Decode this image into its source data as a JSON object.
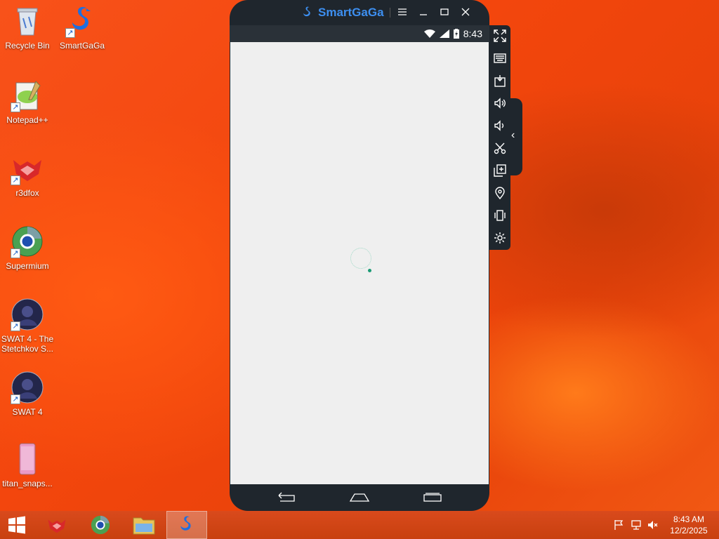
{
  "desktop": {
    "icons": [
      {
        "label": "Recycle Bin"
      },
      {
        "label": "SmartGaGa"
      },
      {
        "label": "Notepad++"
      },
      {
        "label": "r3dfox"
      },
      {
        "label": "Supermium"
      },
      {
        "label": "SWAT 4 - The Stetchkov S..."
      },
      {
        "label": "SWAT 4"
      },
      {
        "label": "titan_snaps..."
      }
    ]
  },
  "emulator": {
    "title": "SmartGaGa",
    "status_time": "8:43",
    "toolbar": [
      "fullscreen-icon",
      "keyboard-icon",
      "apk-install-icon",
      "volume-up-icon",
      "volume-down-icon",
      "screenshot-icon",
      "multi-instance-icon",
      "location-icon",
      "shake-icon",
      "settings-icon"
    ],
    "accent": "#3d8ff0"
  },
  "taskbar": {
    "clock_time": "8:43 AM",
    "clock_date": "12/2/2025",
    "color": "#c8400f"
  }
}
